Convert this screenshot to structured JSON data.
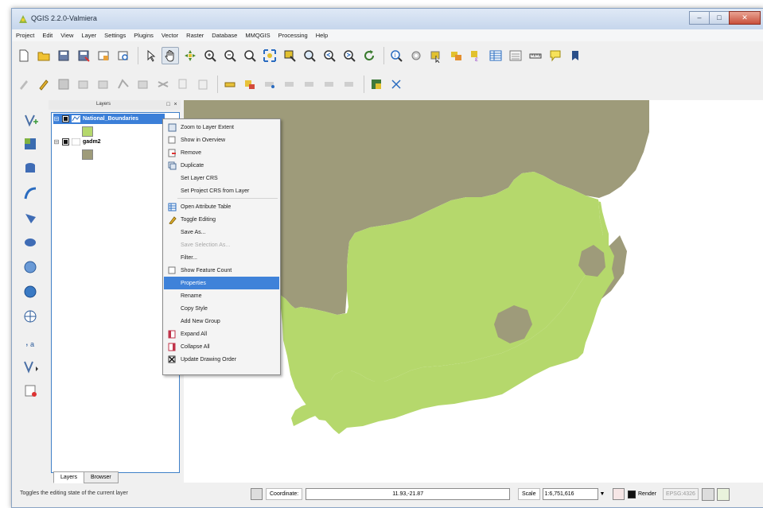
{
  "window": {
    "title": "QGIS 2.2.0-Valmiera"
  },
  "menu": [
    "Project",
    "Edit",
    "View",
    "Layer",
    "Settings",
    "Plugins",
    "Vector",
    "Raster",
    "Database",
    "MMQGIS",
    "Processing",
    "Help"
  ],
  "layers_panel": {
    "title": "Layers",
    "layers": [
      {
        "name": "National_Boundaries",
        "color": "#b5d86c",
        "checked": true,
        "selected": true
      },
      {
        "name": "gadm2",
        "color": "#9e9b7a",
        "checked": true,
        "selected": false
      }
    ],
    "tabs": [
      "Layers",
      "Browser"
    ]
  },
  "context_menu": {
    "items": [
      {
        "label": "Zoom to Layer Extent",
        "icon": "zoom-extent-icon",
        "state": "normal"
      },
      {
        "label": "Show in Overview",
        "icon": "checkbox-icon",
        "state": "normal"
      },
      {
        "label": "Remove",
        "icon": "remove-layer-icon",
        "state": "normal"
      },
      {
        "label": "Duplicate",
        "icon": "duplicate-icon",
        "state": "normal"
      },
      {
        "label": "Set Layer CRS",
        "icon": "",
        "state": "normal"
      },
      {
        "label": "Set Project CRS from Layer",
        "icon": "",
        "state": "normal"
      },
      {
        "label": "Open Attribute Table",
        "icon": "table-icon",
        "state": "normal"
      },
      {
        "label": "Toggle Editing",
        "icon": "pencil-icon",
        "state": "normal"
      },
      {
        "label": "Save As...",
        "icon": "",
        "state": "normal"
      },
      {
        "label": "Save Selection As...",
        "icon": "",
        "state": "disabled"
      },
      {
        "label": "Filter...",
        "icon": "",
        "state": "normal"
      },
      {
        "label": "Show Feature Count",
        "icon": "checkbox-icon",
        "state": "normal"
      },
      {
        "label": "Properties",
        "icon": "",
        "state": "highlighted"
      },
      {
        "label": "Rename",
        "icon": "",
        "state": "normal"
      },
      {
        "label": "Copy Style",
        "icon": "",
        "state": "normal"
      },
      {
        "label": "Add New Group",
        "icon": "",
        "state": "normal"
      },
      {
        "label": "Expand All",
        "icon": "expand-icon",
        "state": "normal"
      },
      {
        "label": "Collapse All",
        "icon": "collapse-icon",
        "state": "normal"
      },
      {
        "label": "Update Drawing Order",
        "icon": "checked-checkbox-icon",
        "state": "normal"
      }
    ]
  },
  "map": {
    "background": "#ffffff",
    "colors": {
      "land": "#9e9b7a",
      "highlight_country": "#b5d86c"
    }
  },
  "status": {
    "message": "Toggles the editing state of the current layer",
    "coordinate_label": "Coordinate:",
    "coordinate_value": "11.93,-21.87",
    "scale_label": "Scale",
    "scale_value": "1:6,751,616",
    "render_label": "Render",
    "epsg": "EPSG:4326"
  },
  "colors": {
    "selection": "#3b7fd8",
    "menu_highlight": "#3f82d9"
  }
}
